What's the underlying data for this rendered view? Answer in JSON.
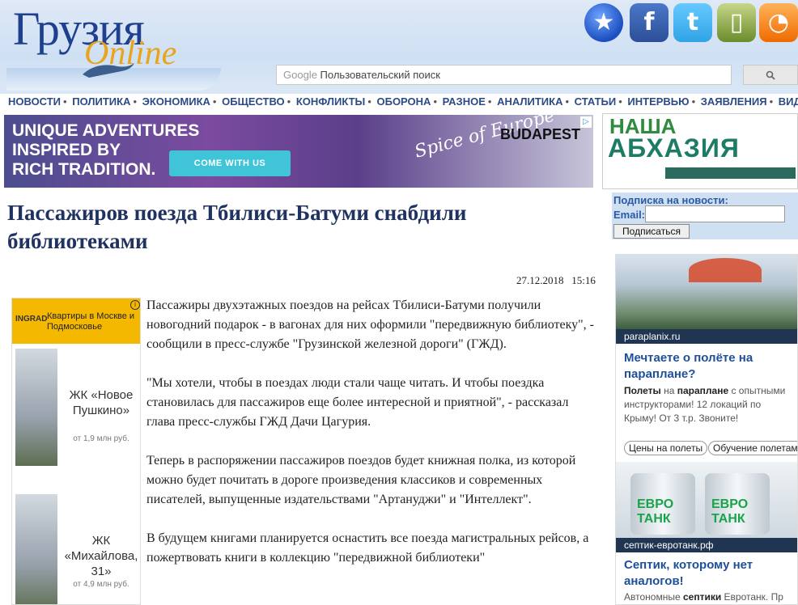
{
  "logo": {
    "word": "Грузия",
    "online": "Online"
  },
  "social": [
    {
      "name": "favorite-star-icon",
      "glyph": "★"
    },
    {
      "name": "facebook-icon",
      "glyph": "f"
    },
    {
      "name": "twitter-icon",
      "glyph": "t"
    },
    {
      "name": "pda-icon",
      "glyph": "▯"
    },
    {
      "name": "rss-icon",
      "glyph": "◔"
    }
  ],
  "search": {
    "google_label": "Google",
    "placeholder": "Пользовательский поиск",
    "button_icon": "search-icon"
  },
  "nav": [
    "НОВОСТИ",
    "ПОЛИТИКА",
    "ЭКОНОМИКА",
    "ОБЩЕСТВО",
    "КОНФЛИКТЫ",
    "ОБОРОНА",
    "РАЗНОЕ",
    "АНАЛИТИКА",
    "СТАТЬИ",
    "ИНТЕРВЬЮ",
    "ЗАЯВЛЕНИЯ",
    "ВИДЕО"
  ],
  "banner": {
    "line1": "UNIQUE ADVENTURES",
    "line2": "INSPIRED BY",
    "line3": "RICH TRADITION.",
    "cta": "COME WITH US",
    "spice": "Spice of Europe",
    "city": "BUDAPEST"
  },
  "abkhazia": {
    "line1": "НАША",
    "line2": "АБХАЗИЯ"
  },
  "subscribe": {
    "label": "Подписка на новости:",
    "email_label": "Email:",
    "button": "Подписаться"
  },
  "article": {
    "title": "Пассажиров поезда Тбилиси-Батуми снабдили библиотеками",
    "date": "27.12.2018",
    "time": "15:16",
    "paragraphs": [
      "Пассажиры двухэтажных поездов на рейсах Тбилиси-Батуми получили новогодний подарок - в вагонах для них оформили \"передвижную библиотеку\", - сообщили в пресс-службе \"Грузинской железной дороги\" (ГЖД).",
      "\"Мы хотели, чтобы в поездах люди стали чаще читать. И чтобы поездка становилась для пассажиров еще более интересной и приятной\", - рассказал глава пресс-службы ГЖД Дачи Цагурия.",
      "Теперь в распоряжении пассажиров поездов будет книжная полка, из которой можно будет почитать в дороге произведения классиков и современных писателей, выпущенные издательствами \"Артануджи\" и \"Интеллект\".",
      "В будущем книгами планируется оснастить все поезда магистральных рейсов, а пожертвовать книги в коллекцию \"передвижной библиотеки\""
    ]
  },
  "left_ad": {
    "brand": "INGRAD",
    "headline": "Квартиры в Москве и Подмосковье",
    "info": "i",
    "items": [
      {
        "name": "ЖК «Новое Пушкино»",
        "price": "от 1,9 млн руб."
      },
      {
        "name": "ЖК «Михайлова, 31»",
        "price": "от 4,9 млн руб."
      }
    ]
  },
  "right_ad": {
    "domain1": "paraplanix.ru",
    "headline1": "Мечтаете о полёте на параплане?",
    "text1_bold": "Полеты",
    "text1_mid": " на ",
    "text1_bold2": "параплане",
    "text1_rest": " с опытными инструкторами! 12 локаций по Крыму! От 3 т.р. Звоните!",
    "pill1": "Цены на полеты",
    "pill2": "Обучение полетам",
    "tank_label": "ЕВРО ТАНК",
    "domain2": "септик-евротанк.рф",
    "headline2": "Септик, которому нет аналогов!",
    "text2_pre": "Автономные ",
    "text2_bold": "септики",
    "text2_rest": " Евротанк. Пр"
  }
}
